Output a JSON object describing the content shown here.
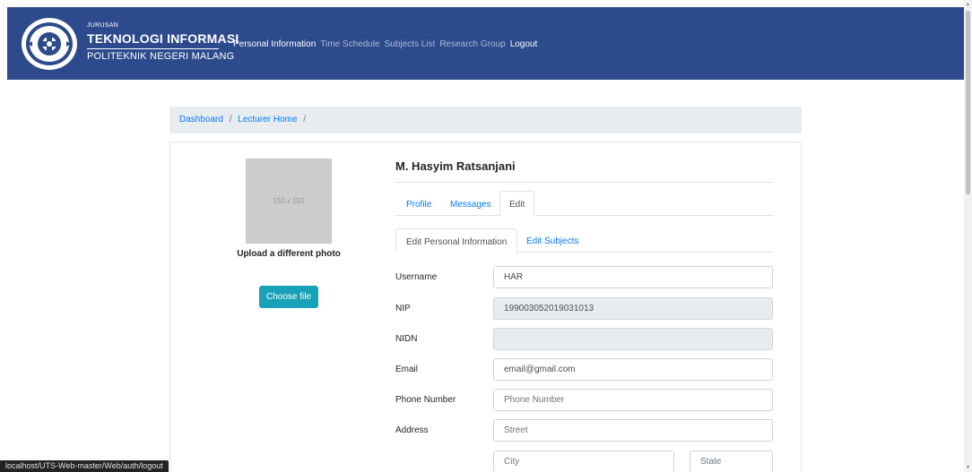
{
  "header": {
    "brand_small": "JURUSAN",
    "brand_main": "TEKNOLOGI INFORMASI",
    "brand_sub": "POLITEKNIK NEGERI MALANG",
    "logo_icon": "polinema-emblem-icon",
    "nav": {
      "personal_information": "Personal Information",
      "time_schedule": "Time Schedule",
      "subjects_list": "Subjects List",
      "research_group": "Research Group",
      "logout": "Logout"
    }
  },
  "breadcrumb": {
    "items": [
      "Dashboard",
      "Lecturer Home"
    ],
    "separator": "/"
  },
  "profile": {
    "photo_placeholder": "150 x 150",
    "upload_label": "Upload a different photo",
    "choose_file": "Choose file",
    "name": "M. Hasyim Ratsanjani",
    "tabs": {
      "profile": "Profile",
      "messages": "Messages",
      "edit": "Edit",
      "active": "Edit"
    },
    "subtabs": {
      "edit_personal": "Edit Personal Information",
      "edit_subjects": "Edit Subjects",
      "active": "Edit Personal Information"
    }
  },
  "form": {
    "username": {
      "label": "Username",
      "value": "HAR"
    },
    "nip": {
      "label": "NIP",
      "value": "199003052019031013"
    },
    "nidn": {
      "label": "NIDN",
      "value": ""
    },
    "email": {
      "label": "Email",
      "value": "email@gmail.com"
    },
    "phone": {
      "label": "Phone Number",
      "placeholder": "Phone Number"
    },
    "address": {
      "label": "Address",
      "street_placeholder": "Street",
      "city_placeholder": "City",
      "state_placeholder": "State"
    }
  },
  "status_bar": {
    "url": "localhost/UTS-Web-master/Web/auth/logout"
  },
  "colors": {
    "navbar": "#2c4a8c",
    "link": "#007bff",
    "choose_button": "#17a2b8",
    "breadcrumb_bg": "#e9ecef"
  }
}
